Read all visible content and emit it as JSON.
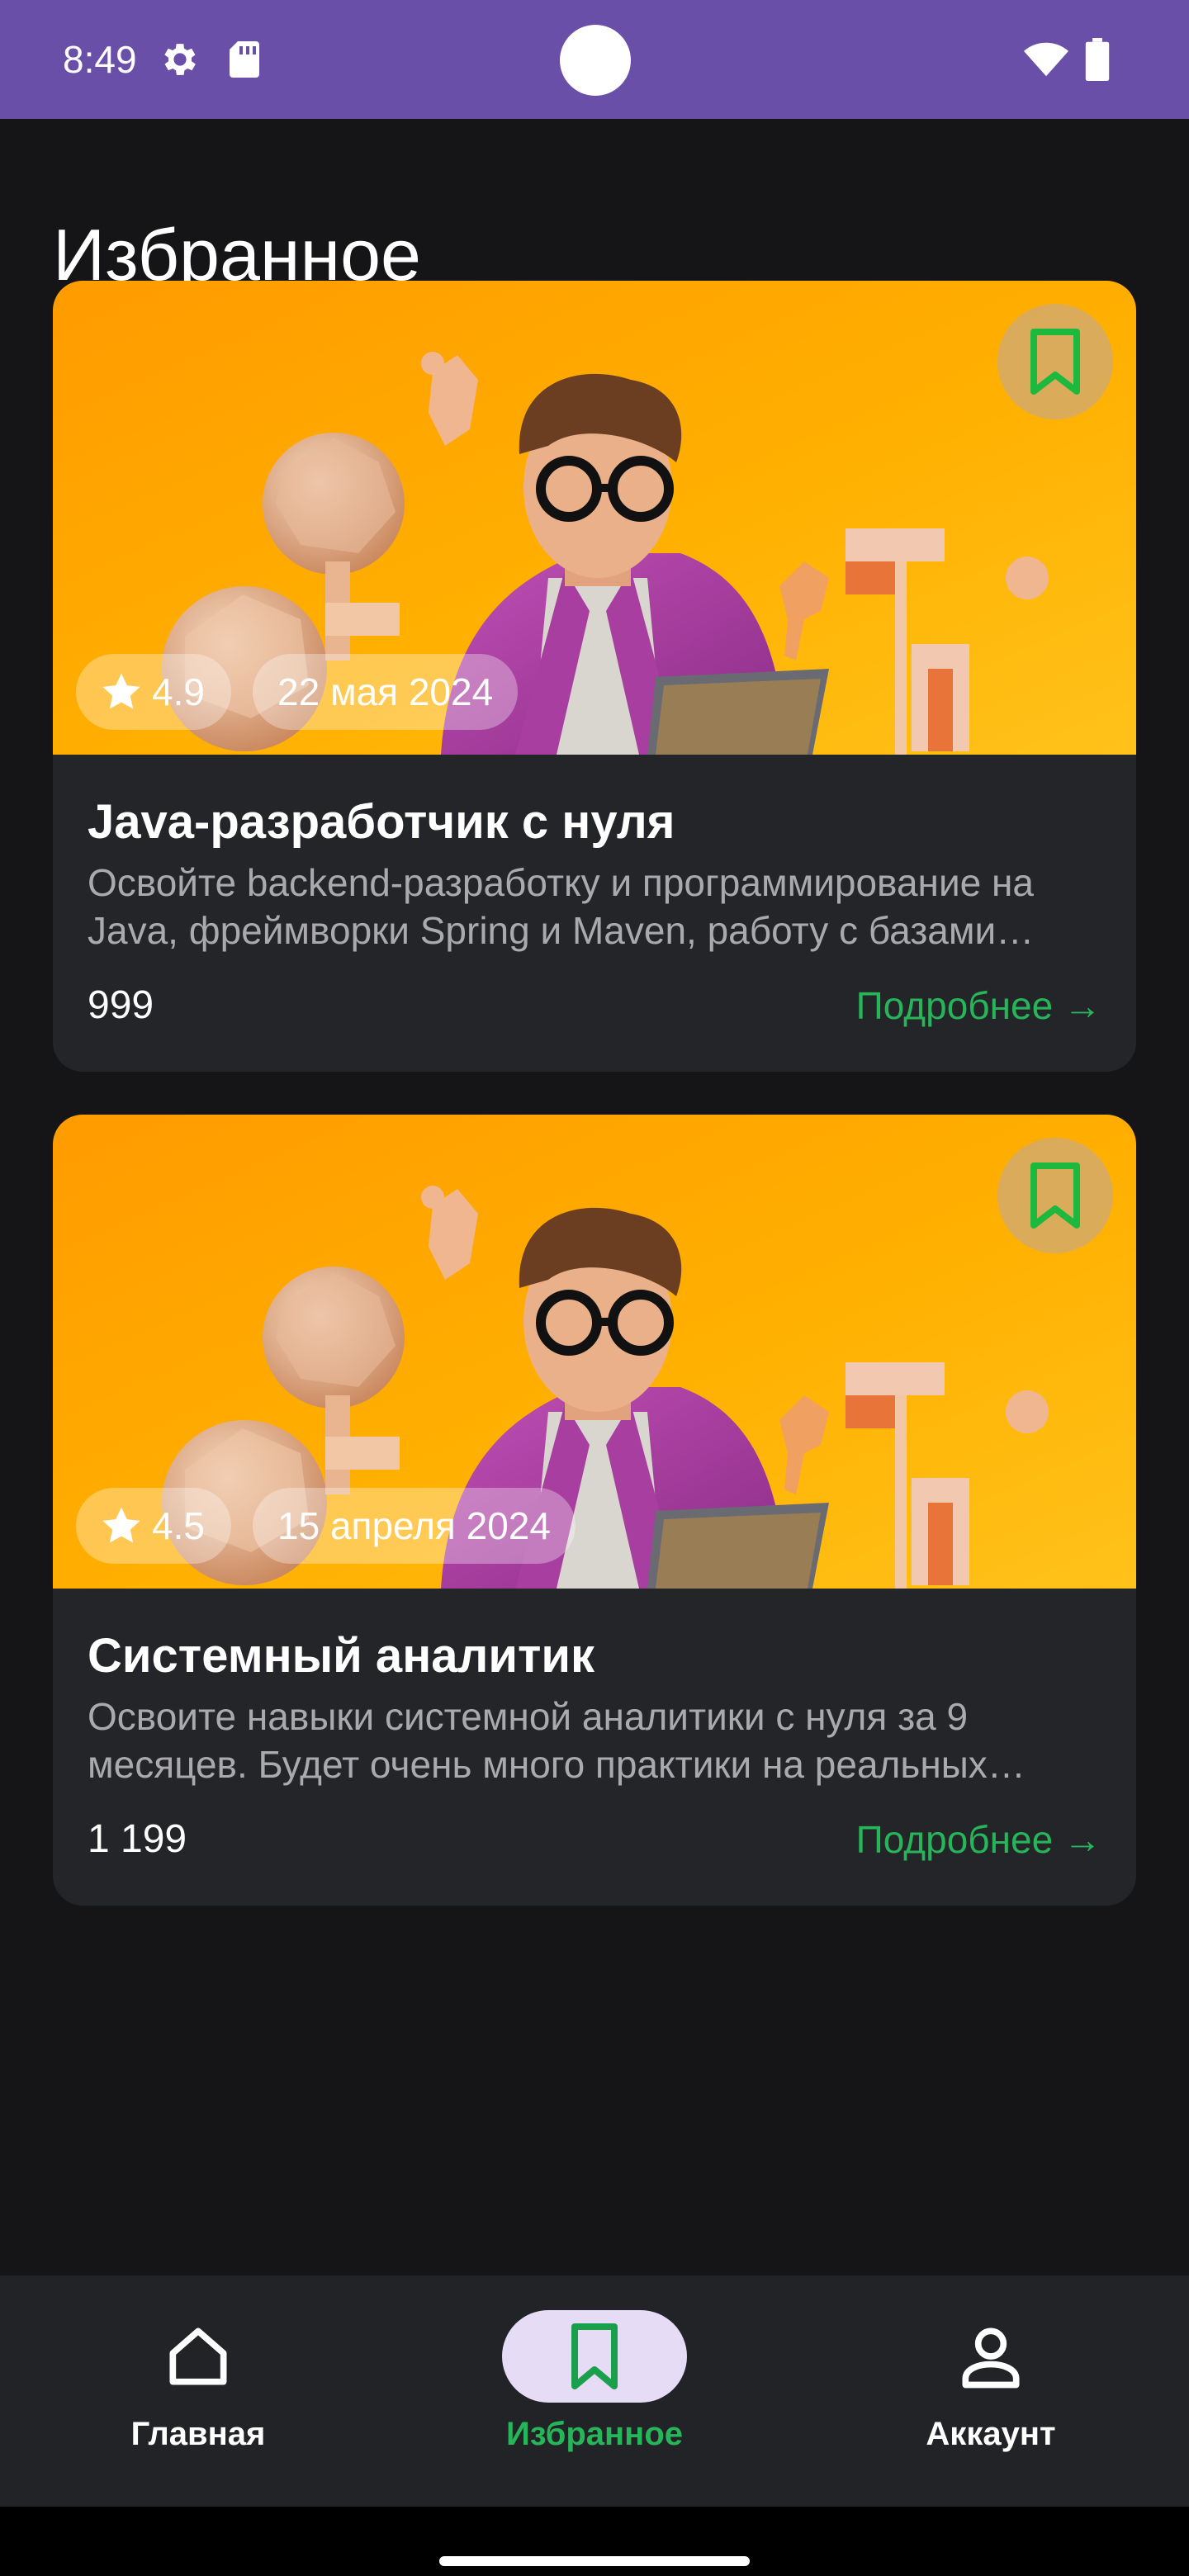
{
  "status_bar": {
    "time": "8:49",
    "icons": [
      "gear-icon",
      "sd-card-icon",
      "wifi-icon",
      "battery-icon"
    ]
  },
  "page": {
    "title": "Избранное"
  },
  "courses": [
    {
      "rating": "4.9",
      "date": "22 мая 2024",
      "title": "Java-разработчик с нуля",
      "description": "Освойте backend-разработку и программирование на Java, фреймворки Spring и Maven, работу с базами данных",
      "price": "999",
      "more_label": "Подробнее →"
    },
    {
      "rating": "4.5",
      "date": "15 апреля 2024",
      "title": "Системный аналитик",
      "description": "Освоите навыки системной аналитики с нуля за 9 месяцев. Будет очень много практики на реальных проектах",
      "price": "1 199",
      "more_label": "Подробнее →"
    }
  ],
  "bottom_nav": {
    "items": [
      {
        "label": "Главная",
        "icon": "home-icon",
        "active": false
      },
      {
        "label": "Избранное",
        "icon": "bookmark-icon",
        "active": true
      },
      {
        "label": "Аккаунт",
        "icon": "person-icon",
        "active": false
      }
    ]
  },
  "colors": {
    "status_bar": "#6a4fa9",
    "background": "#151517",
    "card": "#242529",
    "accent_green": "#27b55a",
    "nav_active_pill": "#e6dcf6"
  }
}
